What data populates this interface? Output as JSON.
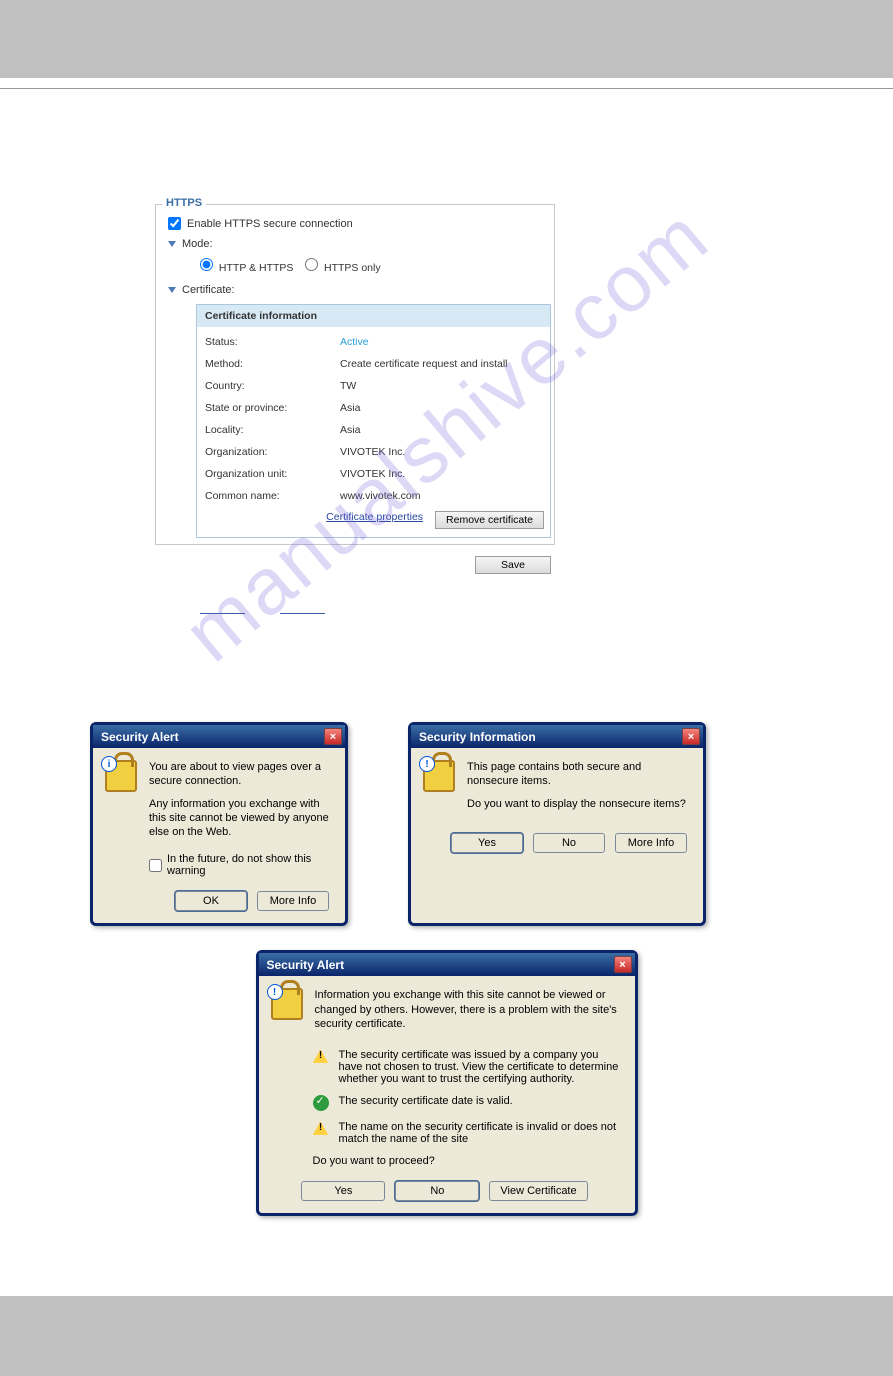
{
  "watermark": "manualshive.com",
  "https_panel": {
    "legend": "HTTPS",
    "enable_label": "Enable HTTPS secure connection",
    "mode_label": "Mode:",
    "radio_http_https": "HTTP & HTTPS",
    "radio_https_only": "HTTPS only",
    "certificate_label": "Certificate:",
    "cert_header": "Certificate information",
    "cert_rows": {
      "status_lbl": "Status:",
      "status_val": "Active",
      "method_lbl": "Method:",
      "method_val": "Create certificate request and install",
      "country_lbl": "Country:",
      "country_val": "TW",
      "state_lbl": "State or province:",
      "state_val": "Asia",
      "locality_lbl": "Locality:",
      "locality_val": "Asia",
      "org_lbl": "Organization:",
      "org_val": "VIVOTEK Inc.",
      "orgunit_lbl": "Organization unit:",
      "orgunit_val": "VIVOTEK Inc.",
      "cname_lbl": "Common name:",
      "cname_val": "www.vivotek.com"
    },
    "cert_props_link": "Certificate properties",
    "remove_cert_btn": "Remove certificate",
    "save_btn": "Save"
  },
  "dialog1": {
    "title": "Security Alert",
    "line1": "You are about to view pages over a secure connection.",
    "line2": "Any information you exchange with this site cannot be viewed by anyone else on the Web.",
    "checkbox": "In the future, do not show this warning",
    "ok": "OK",
    "more_info": "More Info"
  },
  "dialog2": {
    "title": "Security Information",
    "line1": "This page contains both secure and nonsecure items.",
    "line2": "Do you want to display the nonsecure items?",
    "yes": "Yes",
    "no": "No",
    "more_info": "More Info"
  },
  "dialog3": {
    "title": "Security Alert",
    "intro": "Information you exchange with this site cannot be viewed or changed by others. However, there is a problem with the site's security certificate.",
    "warn1": "The security certificate was issued by a company you have not chosen to trust. View the certificate to determine whether you want to trust the certifying authority.",
    "ok1": "The security certificate date is valid.",
    "warn2": "The name on the security certificate is invalid or does not match the name of the site",
    "proceed": "Do you want to proceed?",
    "yes": "Yes",
    "no": "No",
    "view_cert": "View Certificate"
  }
}
